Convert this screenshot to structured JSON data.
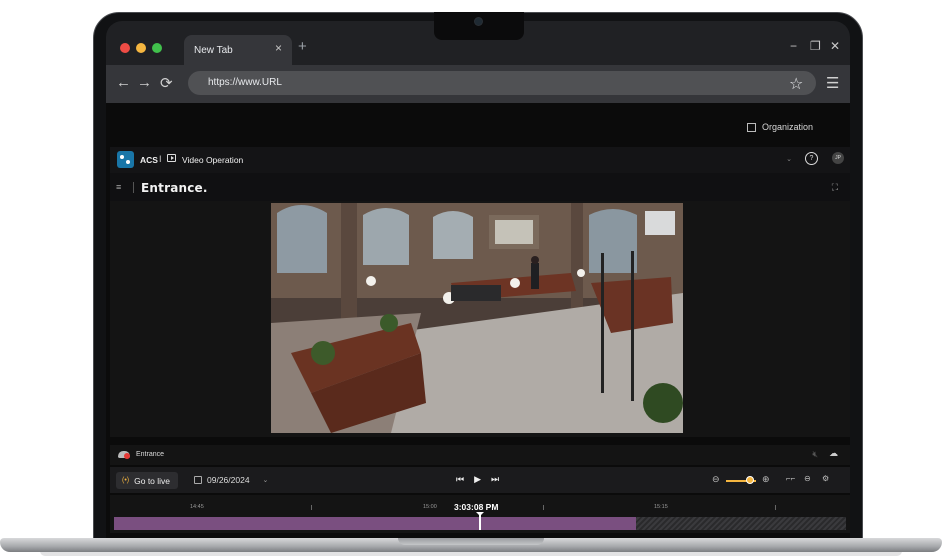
{
  "browser": {
    "tab_title": "New Tab",
    "tab_close": "×",
    "new_tab": "+",
    "window_controls": {
      "minimize": "−",
      "restore": "❐",
      "close": "✕"
    },
    "nav": {
      "back": "←",
      "forward": "→",
      "reload": "⟳"
    },
    "url": "https://www.URL",
    "bookmark_icon": "☆",
    "menu_icon": "☰"
  },
  "app": {
    "organization_label": "Organization",
    "product": "ACS",
    "separator": "I",
    "section": "Video Operation",
    "help": "?",
    "avatar_initials": "JP",
    "chevron": "⌄",
    "camera_title": "Entrance.",
    "status_camera_name": "Entrance",
    "go_live_label": "Go to live",
    "live_icon": "(•)",
    "date": "09/26/2024",
    "transport": {
      "prev": "⏮",
      "play": "▶",
      "next": "⏭"
    },
    "zoom": {
      "out": "⊖",
      "in": "⊕",
      "level": 0.8
    },
    "colors": {
      "accent": "#f5b640",
      "recorded": "#7a4f80",
      "brand": "#1976a8",
      "alert": "#e53935"
    }
  },
  "timeline": {
    "current_time": "3:03:08 PM",
    "ticks": [
      "14:45",
      "15:00",
      "15:15"
    ],
    "recorded_fraction": 0.713,
    "playhead_fraction": 0.499
  }
}
